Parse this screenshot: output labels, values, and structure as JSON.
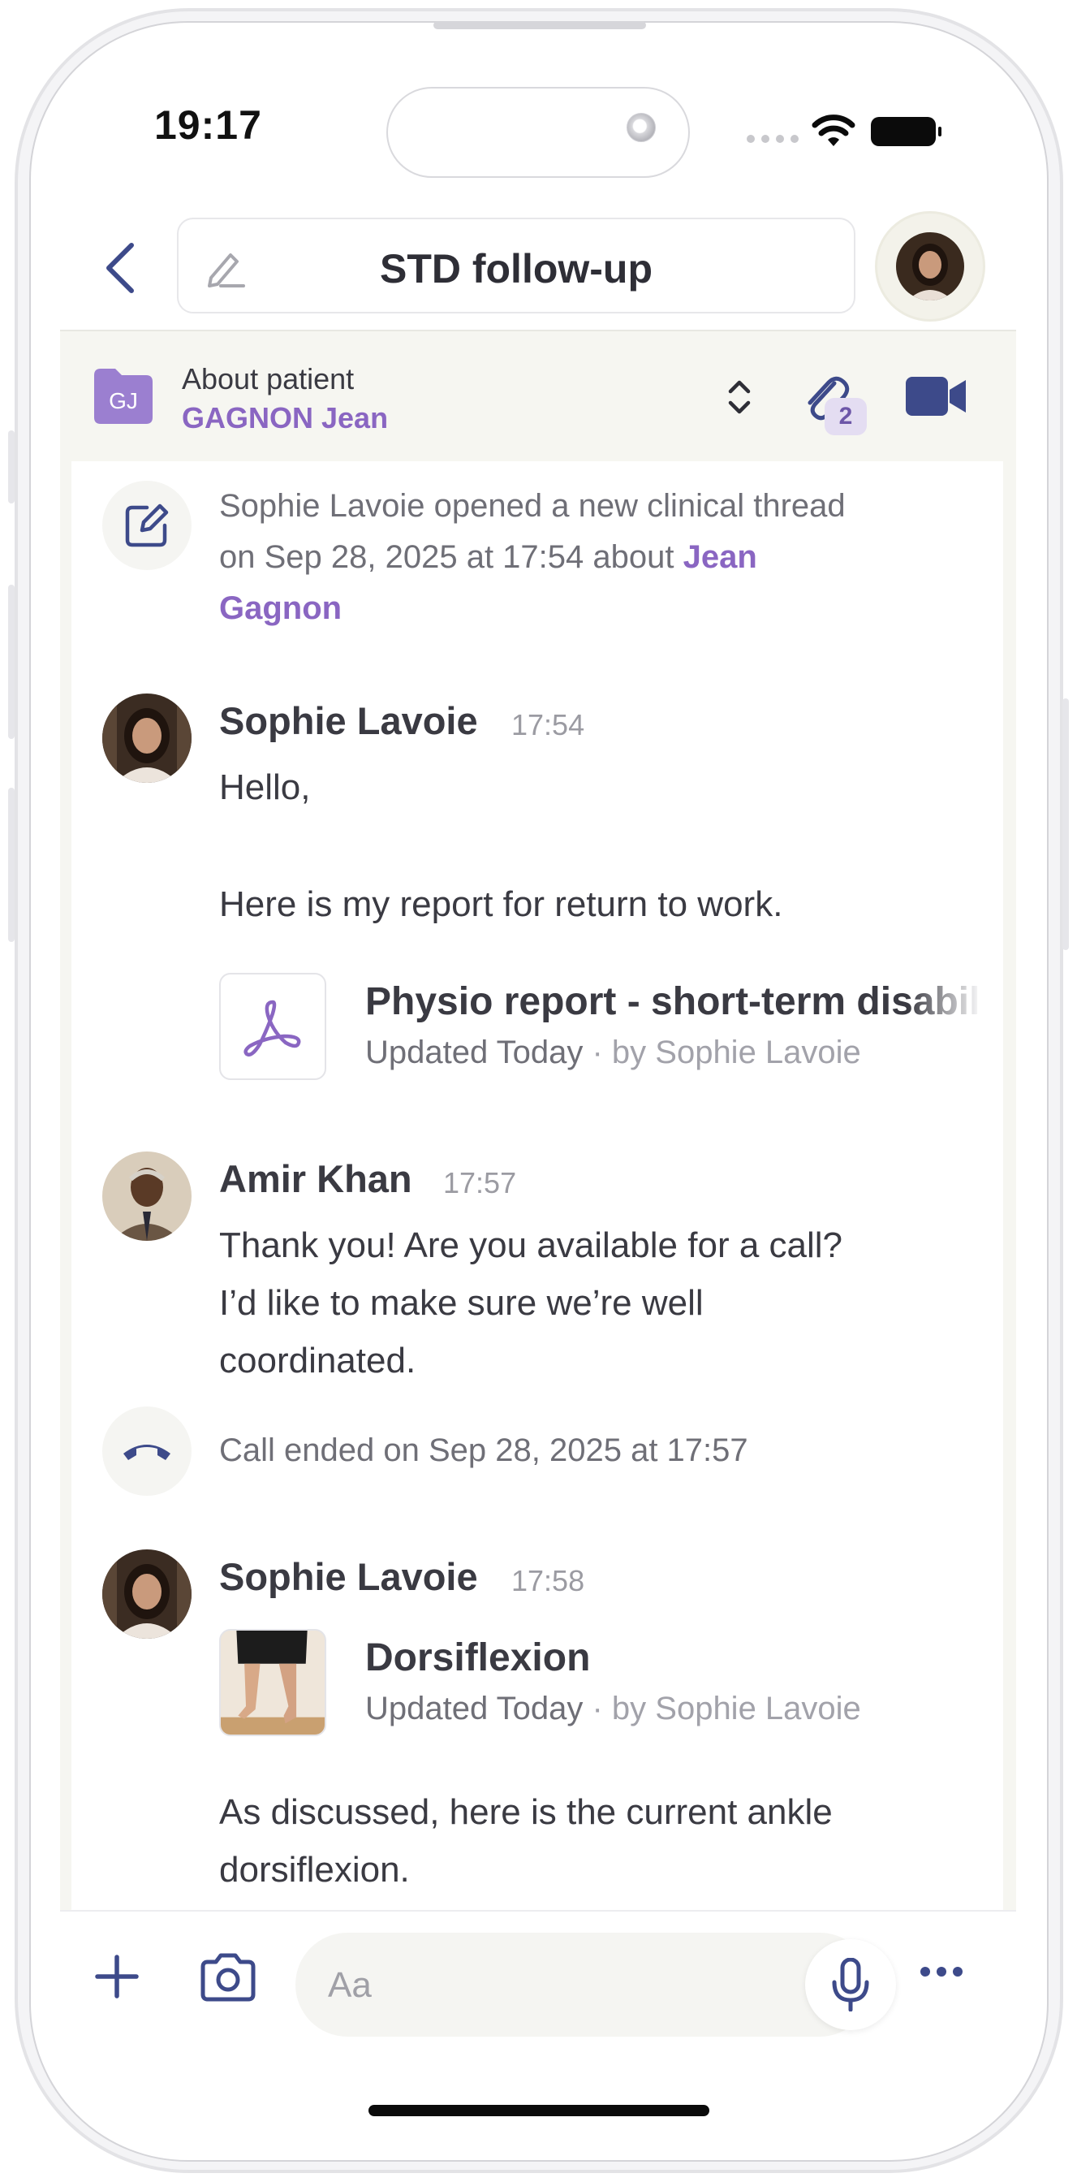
{
  "status_bar": {
    "time": "19:17"
  },
  "header": {
    "title": "STD follow-up"
  },
  "patient_bar": {
    "initials": "GJ",
    "about_label": "About patient",
    "patient_name": "GAGNON Jean",
    "attachments_count": "2"
  },
  "messages": {
    "system_opened": {
      "prefix": "Sophie Lavoie opened a new clinical thread",
      "middle": "on Sep 28, 2025 at 17:54 about ",
      "link_1": "Jean",
      "link_2": "Gagnon"
    },
    "msg1": {
      "author": "Sophie Lavoie",
      "time": "17:54",
      "line1": "Hello,",
      "line2": "Here is my report for return to work.",
      "attachment": {
        "title": "Physio report - short-term disability",
        "meta_updated": "Updated Today",
        "meta_by": " · by Sophie Lavoie",
        "icon": "pdf-icon"
      }
    },
    "msg2": {
      "author": "Amir Khan",
      "time": "17:57",
      "line1": "Thank you! Are you available for a call?",
      "line2": "I’d like to make sure we’re well",
      "line3": "coordinated."
    },
    "system_call": {
      "text": "Call ended on Sep 28, 2025 at 17:57"
    },
    "msg3": {
      "author": "Sophie Lavoie",
      "time": "17:58",
      "attachment": {
        "title": "Dorsiflexion",
        "meta_updated": "Updated Today",
        "meta_by": " · by Sophie Lavoie"
      },
      "line1": "As discussed, here is the current ankle",
      "line2": "dorsiflexion."
    }
  },
  "composer": {
    "placeholder": "Aa"
  },
  "colors": {
    "accent_purple": "#8a66c2",
    "icon_navy": "#3d4a8a",
    "panel_bg": "#f6f6f1"
  }
}
